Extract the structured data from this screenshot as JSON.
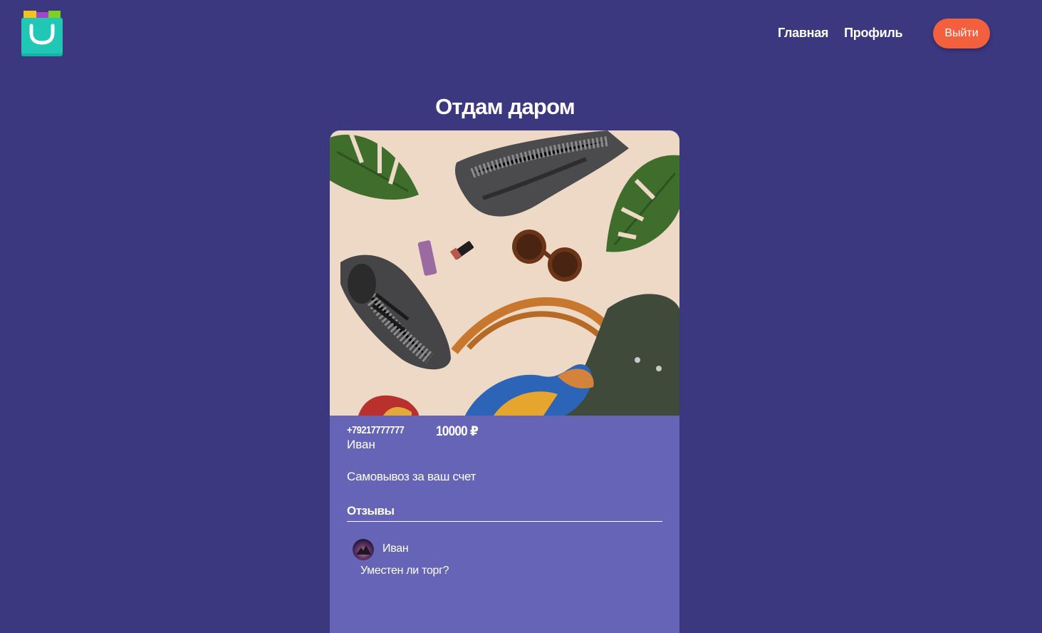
{
  "header": {
    "logo_icon": "shopping-bag-icon",
    "nav": {
      "home_label": "Главная",
      "profile_label": "Профиль"
    },
    "logout_label": "Выйти"
  },
  "page": {
    "title": "Отдам даром"
  },
  "listing": {
    "image": "product-photo",
    "phone": "+79217777777",
    "price": "10000 ₽",
    "seller_name": "Иван",
    "description": "Самовывоз за ваш счет",
    "reviews": {
      "heading": "Отзывы",
      "items": [
        {
          "avatar": "avatar",
          "author": "Иван",
          "text": "Уместен ли торг?"
        }
      ]
    }
  },
  "colors": {
    "background": "#3b3880",
    "card": "#6664b6",
    "accent": "#f2603e",
    "logo": "#1fc7b4"
  }
}
